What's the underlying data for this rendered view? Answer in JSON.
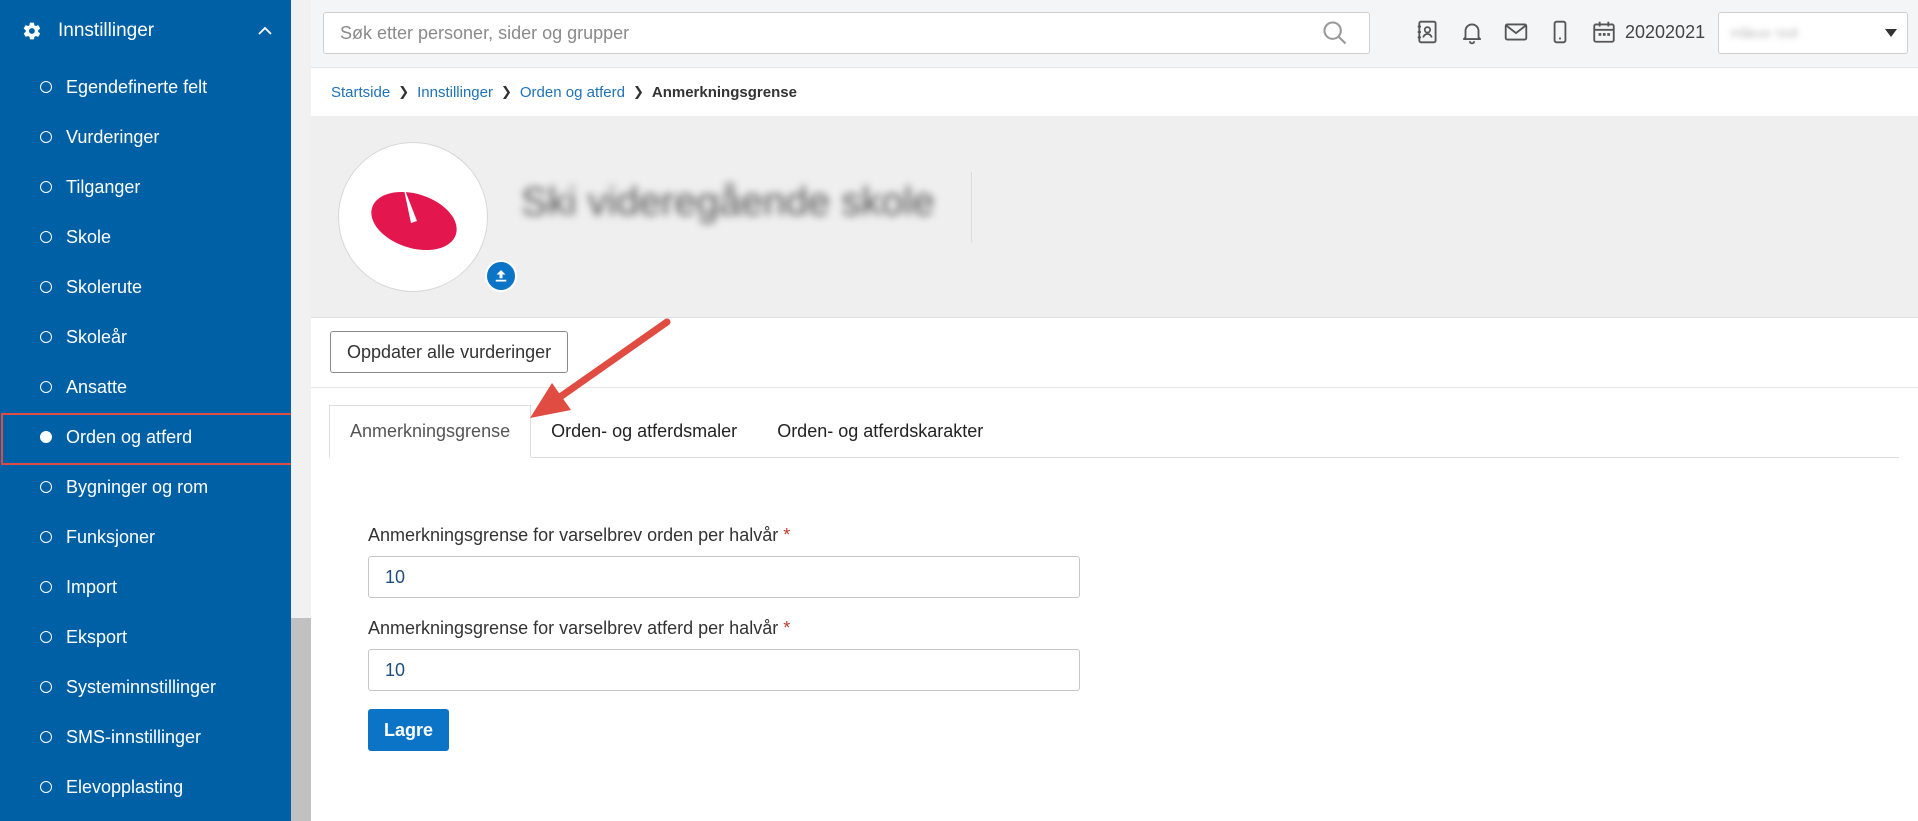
{
  "sidebar": {
    "header": {
      "label": "Innstillinger",
      "icon": "gear-icon"
    },
    "items": [
      {
        "label": "Egendefinerte felt",
        "active": false
      },
      {
        "label": "Vurderinger",
        "active": false
      },
      {
        "label": "Tilganger",
        "active": false
      },
      {
        "label": "Skole",
        "active": false
      },
      {
        "label": "Skolerute",
        "active": false
      },
      {
        "label": "Skoleår",
        "active": false
      },
      {
        "label": "Ansatte",
        "active": false
      },
      {
        "label": "Orden og atferd",
        "active": true
      },
      {
        "label": "Bygninger og rom",
        "active": false
      },
      {
        "label": "Funksjoner",
        "active": false
      },
      {
        "label": "Import",
        "active": false
      },
      {
        "label": "Eksport",
        "active": false
      },
      {
        "label": "Systeminnstillinger",
        "active": false
      },
      {
        "label": "SMS-innstillinger",
        "active": false
      },
      {
        "label": "Elevopplasting",
        "active": false
      }
    ]
  },
  "topbar": {
    "search_placeholder": "Søk etter personer, sider og grupper",
    "year": "20202021",
    "user_name": "Håkon Voll"
  },
  "breadcrumb": {
    "items": [
      "Startside",
      "Innstillinger",
      "Orden og atferd"
    ],
    "current": "Anmerkningsgrense"
  },
  "profile": {
    "school_name": "Ski videregående skole"
  },
  "actions": {
    "update_all": "Oppdater alle vurderinger"
  },
  "tabs": [
    {
      "label": "Anmerkningsgrense",
      "active": true
    },
    {
      "label": "Orden- og atferdsmaler",
      "active": false
    },
    {
      "label": "Orden- og atferdskarakter",
      "active": false
    }
  ],
  "form": {
    "fields": [
      {
        "label": "Anmerkningsgrense for varselbrev orden per halvår",
        "required": "*",
        "value": "10"
      },
      {
        "label": "Anmerkningsgrense for varselbrev atferd per halvår",
        "required": "*",
        "value": "10"
      }
    ],
    "save_label": "Lagre"
  },
  "colors": {
    "sidebar_bg": "#0060a6",
    "accent": "#0b74c7",
    "highlight": "#e04b42",
    "logo_red": "#e3174d"
  }
}
